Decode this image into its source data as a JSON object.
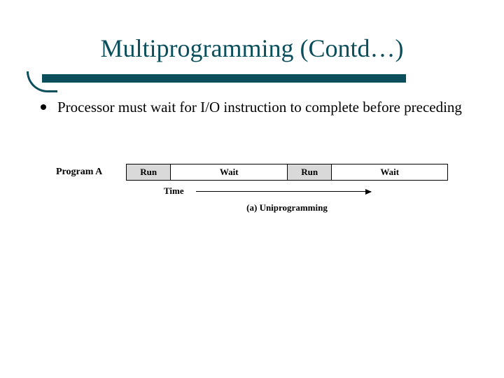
{
  "title": "Multiprogramming (Contd…)",
  "bullet": "Processor must wait for I/O instruction to complete before preceding",
  "diagram": {
    "row_label": "Program A",
    "segments": {
      "run1": "Run",
      "wait1": "Wait",
      "run2": "Run",
      "wait2": "Wait"
    },
    "time_label": "Time",
    "caption": "(a) Uniprogramming"
  }
}
